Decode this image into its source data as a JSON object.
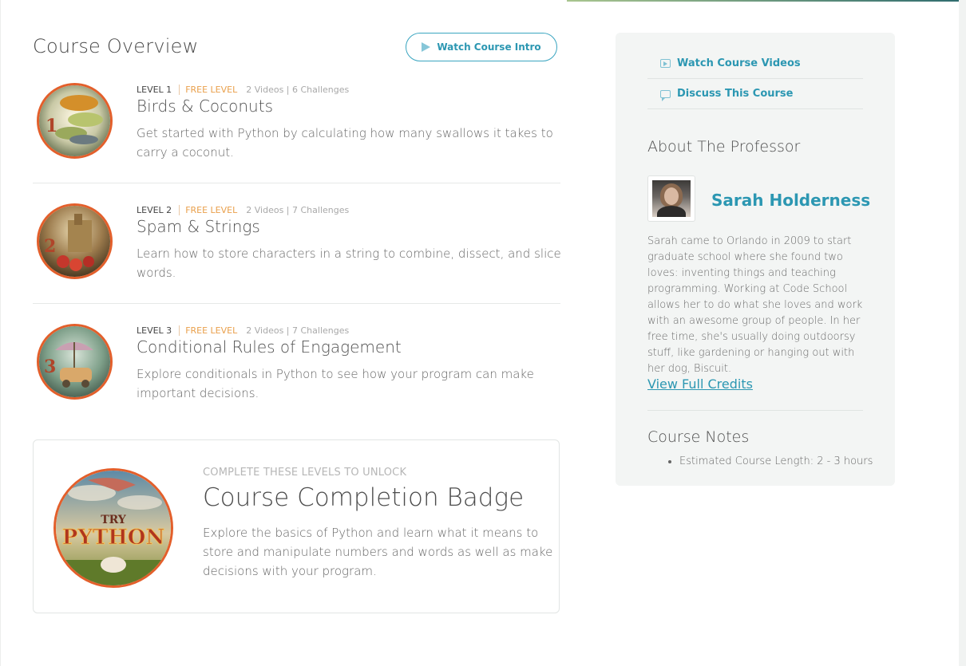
{
  "overview": {
    "title": "Course Overview",
    "intro_button": "Watch Course Intro"
  },
  "levels": [
    {
      "level": "LEVEL 1",
      "free": "FREE LEVEL",
      "counts": "2 Videos | 6 Challenges",
      "title": "Birds & Coconuts",
      "description": "Get started with Python by calculating how many swallows it takes to carry a coconut."
    },
    {
      "level": "LEVEL 2",
      "free": "FREE LEVEL",
      "counts": "2 Videos | 7 Challenges",
      "title": "Spam & Strings",
      "description": "Learn how to store characters in a string to combine, dissect, and slice words."
    },
    {
      "level": "LEVEL 3",
      "free": "FREE LEVEL",
      "counts": "2 Videos | 7 Challenges",
      "title": "Conditional Rules of Engagement",
      "description": "Explore conditionals in Python to see how your program can make important decisions."
    }
  ],
  "completion": {
    "unlock_label": "COMPLETE THESE LEVELS TO UNLOCK",
    "title": "Course Completion Badge",
    "description": "Explore the basics of Python and learn what it means to store and manipulate numbers and words as well as make decisions with your program.",
    "badge_text_top": "TRY",
    "badge_text_main": "PYTHON"
  },
  "sidebar": {
    "links": [
      "Watch Course Videos",
      "Discuss This Course"
    ],
    "professor_heading": "About The Professor",
    "professor_name": "Sarah Holderness",
    "bio": "Sarah came to Orlando in 2009 to start graduate school where she found two loves: inventing things and teaching programming. Working at Code School allows her to do what she loves and work with an awesome group of people. In her free time, she's usually doing outdoorsy stuff, like gardening or hanging out with her dog, Biscuit.",
    "credits_link": "View Full Credits",
    "notes_heading": "Course Notes",
    "notes": [
      "Estimated Course Length: 2 - 3 hours"
    ]
  },
  "colors": {
    "accent": "#2c97b2",
    "free_level": "#e9a04c",
    "badge_ring": "#e35f2b"
  },
  "icons": {
    "intro": "play-icon",
    "videos": "video-icon",
    "discuss": "chat-bubble-icon"
  }
}
